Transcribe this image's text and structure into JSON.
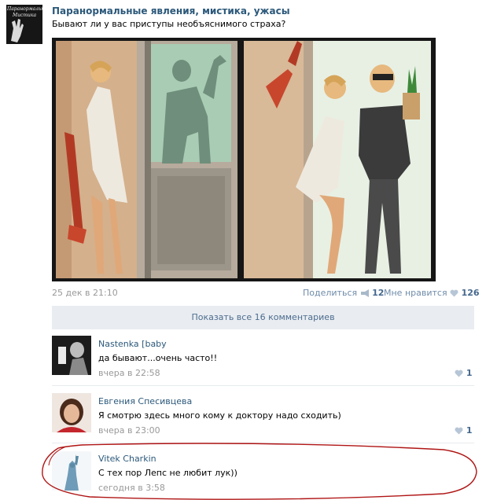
{
  "post": {
    "group_name": "Паранормальные явления, мистика, ужасы",
    "avatar_logo_text": "Паранормальные Мистика",
    "text": "Бывают ли у вас приступы необъяснимого страха?",
    "date": "25 дек в 21:10",
    "share_label": "Поделиться",
    "share_count": "12",
    "like_label": "Мне нравится",
    "like_count": "126"
  },
  "comments_bar": {
    "show_all_label": "Показать все 16 комментариев"
  },
  "comments": [
    {
      "author": "Nastenka [baby",
      "text": "да бывают...очень часто!!",
      "time": "вчера в 22:58",
      "likes": "1"
    },
    {
      "author": "Евгения Спесивцева",
      "text": "Я смотрю здесь много кому к доктору надо сходить)",
      "time": "вчера в 23:00",
      "likes": "1"
    },
    {
      "author": "Vitek Charkin",
      "text": "С тех пор Лепс не любит лук))",
      "time": "сегодня в 3:58"
    }
  ],
  "icons": {
    "share": "megaphone-icon",
    "like": "heart-icon",
    "comment_like": "heart-icon"
  },
  "colors": {
    "link": "#2b587a",
    "muted": "#999999",
    "bar_bg": "#e9edf1",
    "annotation": "#b01515"
  }
}
